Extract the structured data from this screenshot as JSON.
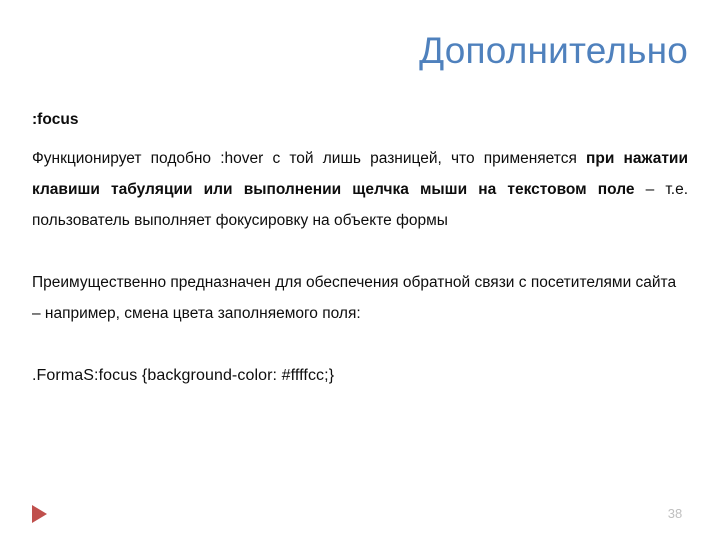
{
  "slide": {
    "title": "Дополнительно",
    "title_color": "#4f81bd",
    "background_color": "#ffffff",
    "body_text_color": "#0d0d0d"
  },
  "body": {
    "heading": ":focus",
    "paragraph1": {
      "run1": "Функционирует подобно :hover с той лишь разницей, что применяется ",
      "run2_bold": "при нажатии клавиши табуляции или выполнении щелчка мыши на текстовом поле",
      "run3": " – т.е. пользователь выполняет фокусировку на объекте формы"
    },
    "paragraph2": "Преимущественно предназначен для обеспечения обратной связи с посетителями сайта – например, смена цвета заполняемого поля:",
    "code": ".FormaS:focus {background-color: #ffffcc;}"
  },
  "footer": {
    "page_number": "38",
    "page_number_color": "#bfbfbf",
    "triangle_icon": "play-triangle-icon",
    "triangle_color": "#c0504d"
  }
}
